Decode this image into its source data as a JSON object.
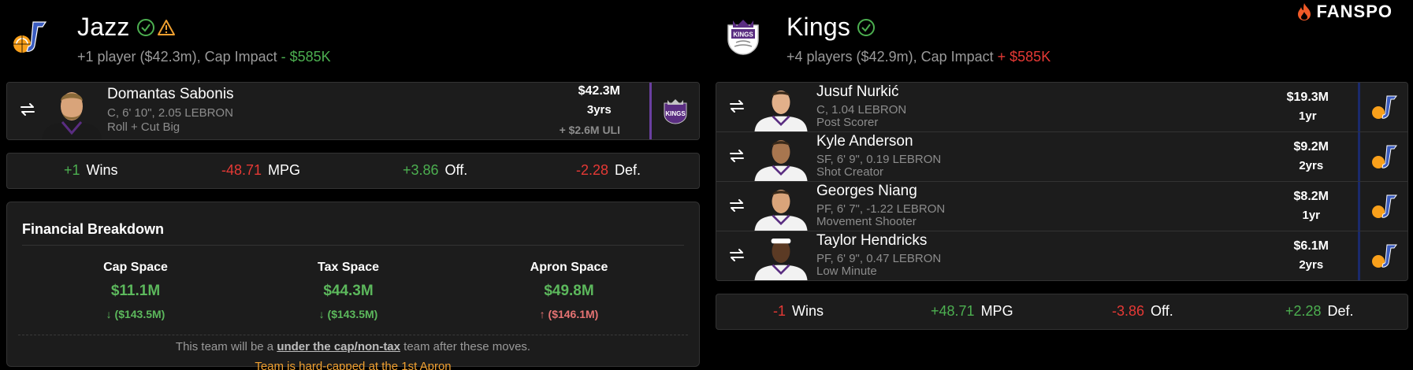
{
  "brand": "FANSPO",
  "colors": {
    "positive": "#4caf50",
    "negative": "#e53935",
    "jazz_purple": "#6a3fa0",
    "kings_purple": "#5a2d81",
    "jazz_navy": "#1a2a6c"
  },
  "left_team": {
    "name": "Jazz",
    "summary_prefix": "+1 player ($42.3m), Cap Impact",
    "cap_impact": "- $585K",
    "players": [
      {
        "name": "Domantas Sabonis",
        "meta": "C, 6' 10\", 2.05 LEBRON",
        "role": "Roll + Cut Big",
        "salary": "$42.3M",
        "years": "3yrs",
        "uli": "+ $2.6M ULI"
      }
    ],
    "stats": [
      {
        "value": "+1",
        "label": "Wins"
      },
      {
        "value": "-48.71",
        "label": "MPG"
      },
      {
        "value": "+3.86",
        "label": "Off."
      },
      {
        "value": "-2.28",
        "label": "Def."
      }
    ],
    "financial": {
      "title": "Financial Breakdown",
      "columns": [
        {
          "label": "Cap Space",
          "value": "$11.1M",
          "delta": "($143.5M)",
          "dir": "down"
        },
        {
          "label": "Tax Space",
          "value": "$44.3M",
          "delta": "($143.5M)",
          "dir": "down"
        },
        {
          "label": "Apron Space",
          "value": "$49.8M",
          "delta": "($146.1M)",
          "dir": "up"
        }
      ],
      "note_prefix": "This team will be a",
      "note_status": "under the cap/non-tax",
      "note_suffix": "team after these moves.",
      "warning": "Team is hard-capped at the 1st Apron"
    }
  },
  "right_team": {
    "name": "Kings",
    "summary_prefix": "+4 players ($42.9m), Cap Impact",
    "cap_impact": "+ $585K",
    "players": [
      {
        "name": "Jusuf Nurkić",
        "meta": "C, 1.04 LEBRON",
        "role": "Post Scorer",
        "salary": "$19.3M",
        "years": "1yr"
      },
      {
        "name": "Kyle Anderson",
        "meta": "SF, 6' 9\", 0.19 LEBRON",
        "role": "Shot Creator",
        "salary": "$9.2M",
        "years": "2yrs"
      },
      {
        "name": "Georges Niang",
        "meta": "PF, 6' 7\", -1.22 LEBRON",
        "role": "Movement Shooter",
        "salary": "$8.2M",
        "years": "1yr"
      },
      {
        "name": "Taylor Hendricks",
        "meta": "PF, 6' 9\", 0.47 LEBRON",
        "role": "Low Minute",
        "salary": "$6.1M",
        "years": "2yrs"
      }
    ],
    "stats": [
      {
        "value": "-1",
        "label": "Wins"
      },
      {
        "value": "+48.71",
        "label": "MPG"
      },
      {
        "value": "-3.86",
        "label": "Off."
      },
      {
        "value": "+2.28",
        "label": "Def."
      }
    ]
  }
}
